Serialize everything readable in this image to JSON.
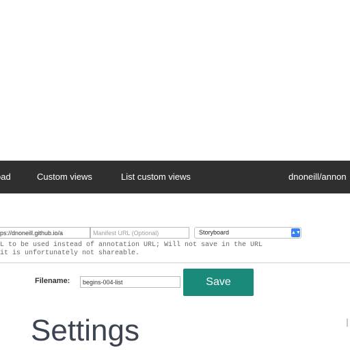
{
  "navbar": {
    "items": [
      {
        "label": "oad"
      },
      {
        "label": "Custom views"
      },
      {
        "label": "List custom views"
      },
      {
        "label": "dnoneill/annon"
      }
    ]
  },
  "toolbar": {
    "url_value": "ps://dnoneill.github.io/a",
    "manifest_placeholder": "Manifest URL (Optional)",
    "view_select": {
      "selected": "Storyboard"
    }
  },
  "help": {
    "line1": "L to be used instead of annotation URL; Will not save in the URL",
    "line2": "it is unfortunately not shareable."
  },
  "form": {
    "filename_label": "Filename:",
    "filename_value": "begins-004-list",
    "save_label": "Save"
  },
  "settings": {
    "title": "Settings"
  },
  "colors": {
    "navbar": "#2f2f2f",
    "save_button": "#1a8a7a",
    "select_arrow": "#3b82f6"
  }
}
